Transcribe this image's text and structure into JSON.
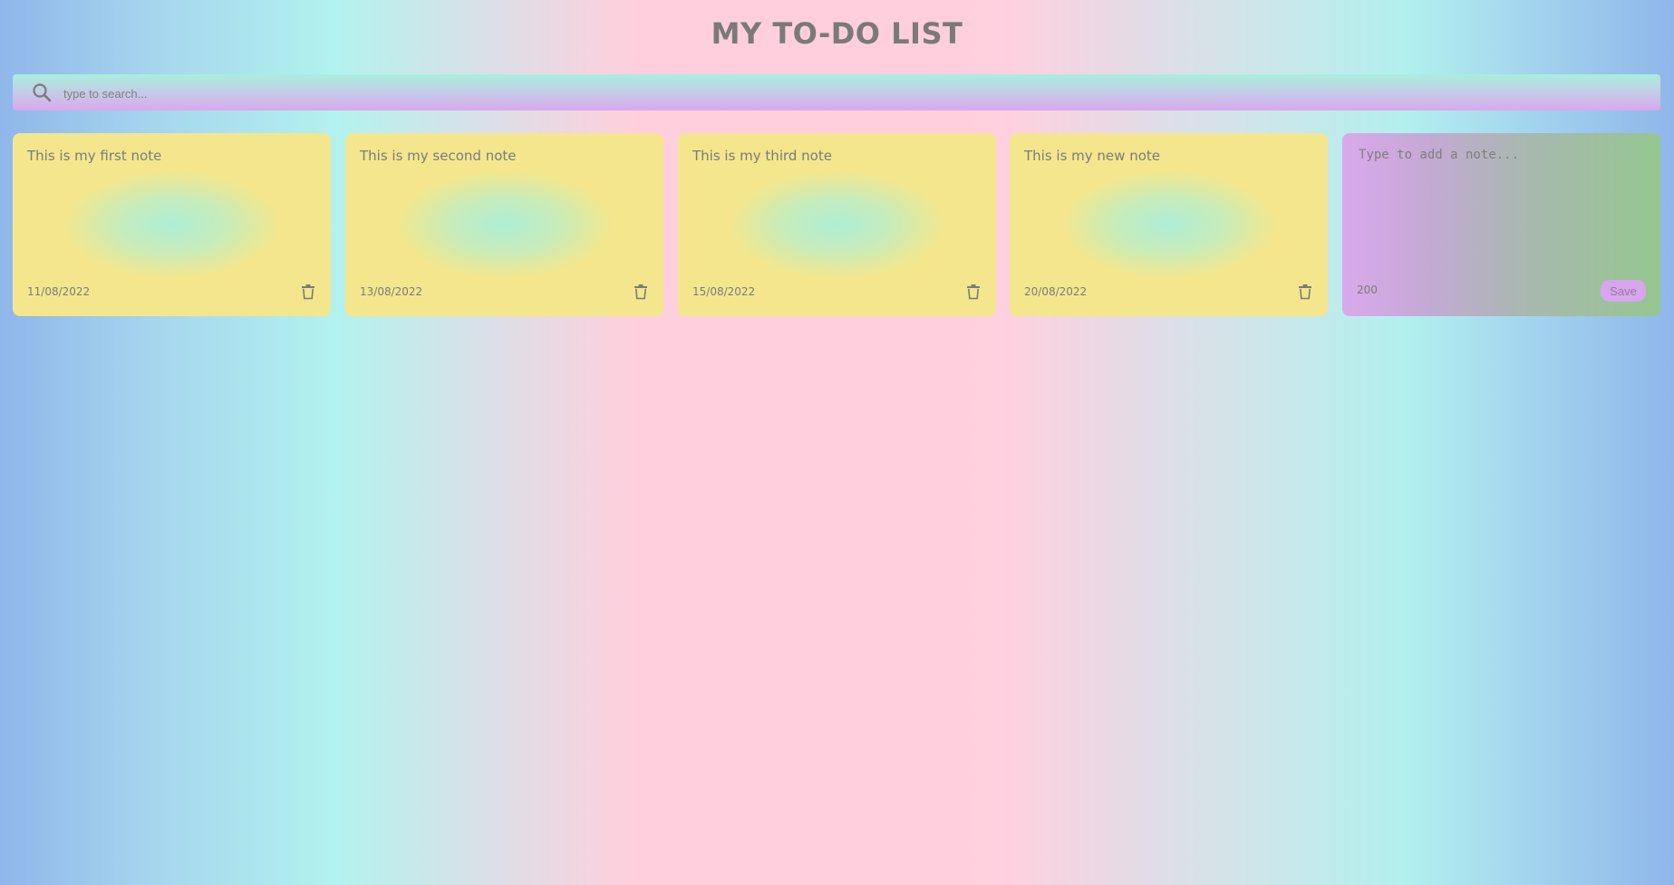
{
  "header": {
    "title": "MY TO-DO LIST"
  },
  "search": {
    "placeholder": "type to search...",
    "value": "",
    "icon": "search-icon"
  },
  "notes": [
    {
      "text": "This is my first note",
      "date": "11/08/2022",
      "delete_icon": "trash-icon"
    },
    {
      "text": "This is my second note",
      "date": "13/08/2022",
      "delete_icon": "trash-icon"
    },
    {
      "text": "This is my third note",
      "date": "15/08/2022",
      "delete_icon": "trash-icon"
    },
    {
      "text": "This is my new note",
      "date": "20/08/2022",
      "delete_icon": "trash-icon"
    }
  ],
  "new_note": {
    "placeholder": "Type to add a note...",
    "value": "",
    "remaining": "200",
    "save_label": "Save"
  },
  "colors": {
    "text": "#7a7a7a",
    "save_button": "#d7a6ef",
    "note_yellow": "#f4e68d",
    "note_mint": "#aeeed6"
  }
}
